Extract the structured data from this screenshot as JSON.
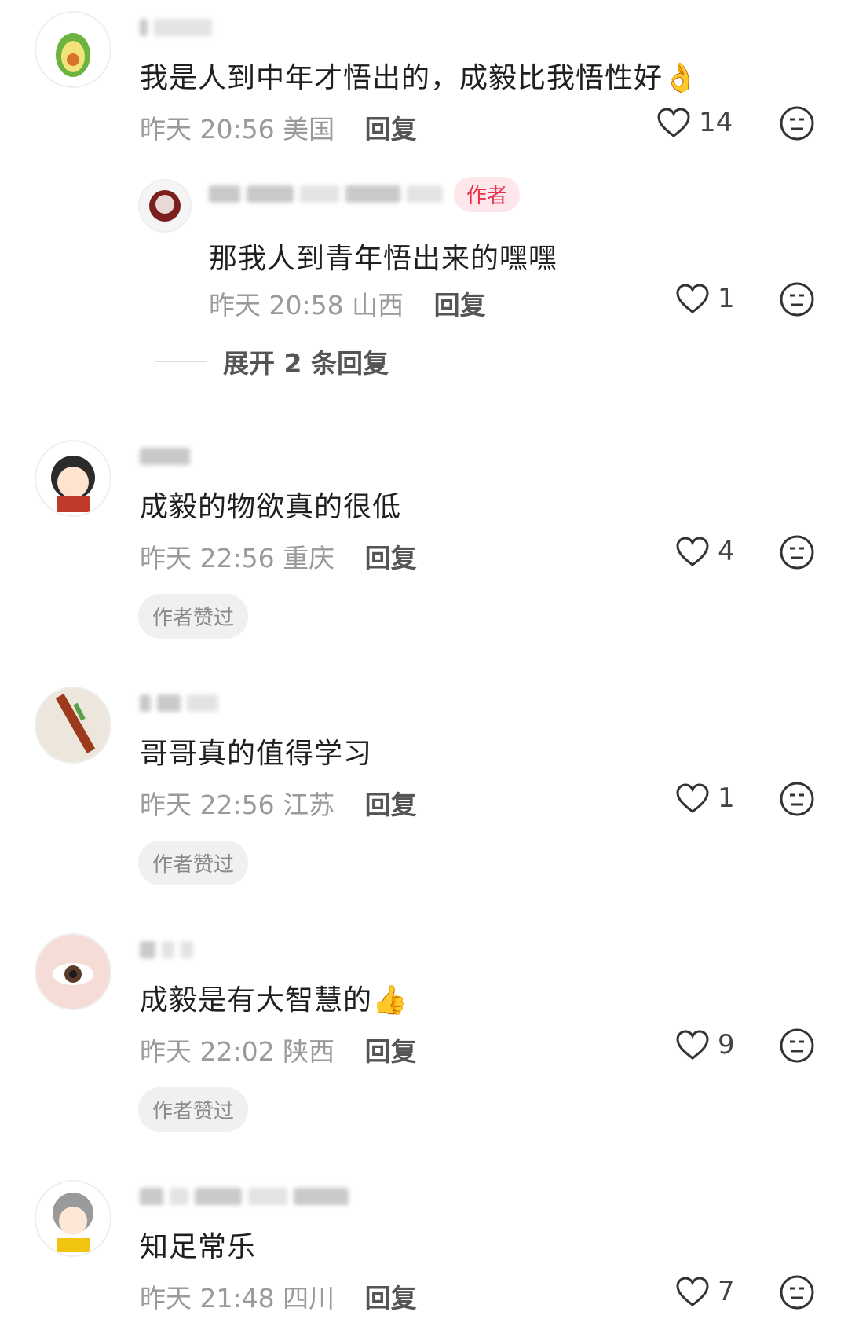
{
  "comments": [
    {
      "text": "我是人到中年才悟出的，成毅比我悟性好👌",
      "time": "昨天 20:56",
      "location": "美国",
      "reply_label": "回复",
      "likes": "14",
      "reply": {
        "author_tag": "作者",
        "text": "那我人到青年悟出来的嘿嘿",
        "time": "昨天 20:58",
        "location": "山西",
        "reply_label": "回复",
        "likes": "1"
      },
      "expand_label": "展开 2 条回复"
    },
    {
      "text": "成毅的物欲真的很低",
      "time": "昨天 22:56",
      "location": "重庆",
      "reply_label": "回复",
      "likes": "4",
      "praised": "作者赞过"
    },
    {
      "text": "哥哥真的值得学习",
      "time": "昨天 22:56",
      "location": "江苏",
      "reply_label": "回复",
      "likes": "1",
      "praised": "作者赞过"
    },
    {
      "text": "成毅是有大智慧的👍",
      "time": "昨天 22:02",
      "location": "陕西",
      "reply_label": "回复",
      "likes": "9",
      "praised": "作者赞过"
    },
    {
      "text": "知足常乐",
      "time": "昨天 21:48",
      "location": "四川",
      "reply_label": "回复",
      "likes": "7"
    }
  ],
  "colors": {
    "author_tag": "#e8304a",
    "meta": "#9a9a9a",
    "text": "#1f1f1f"
  },
  "icons": {
    "like": "heart-outline-icon",
    "dislike": "neutral-face-icon"
  }
}
